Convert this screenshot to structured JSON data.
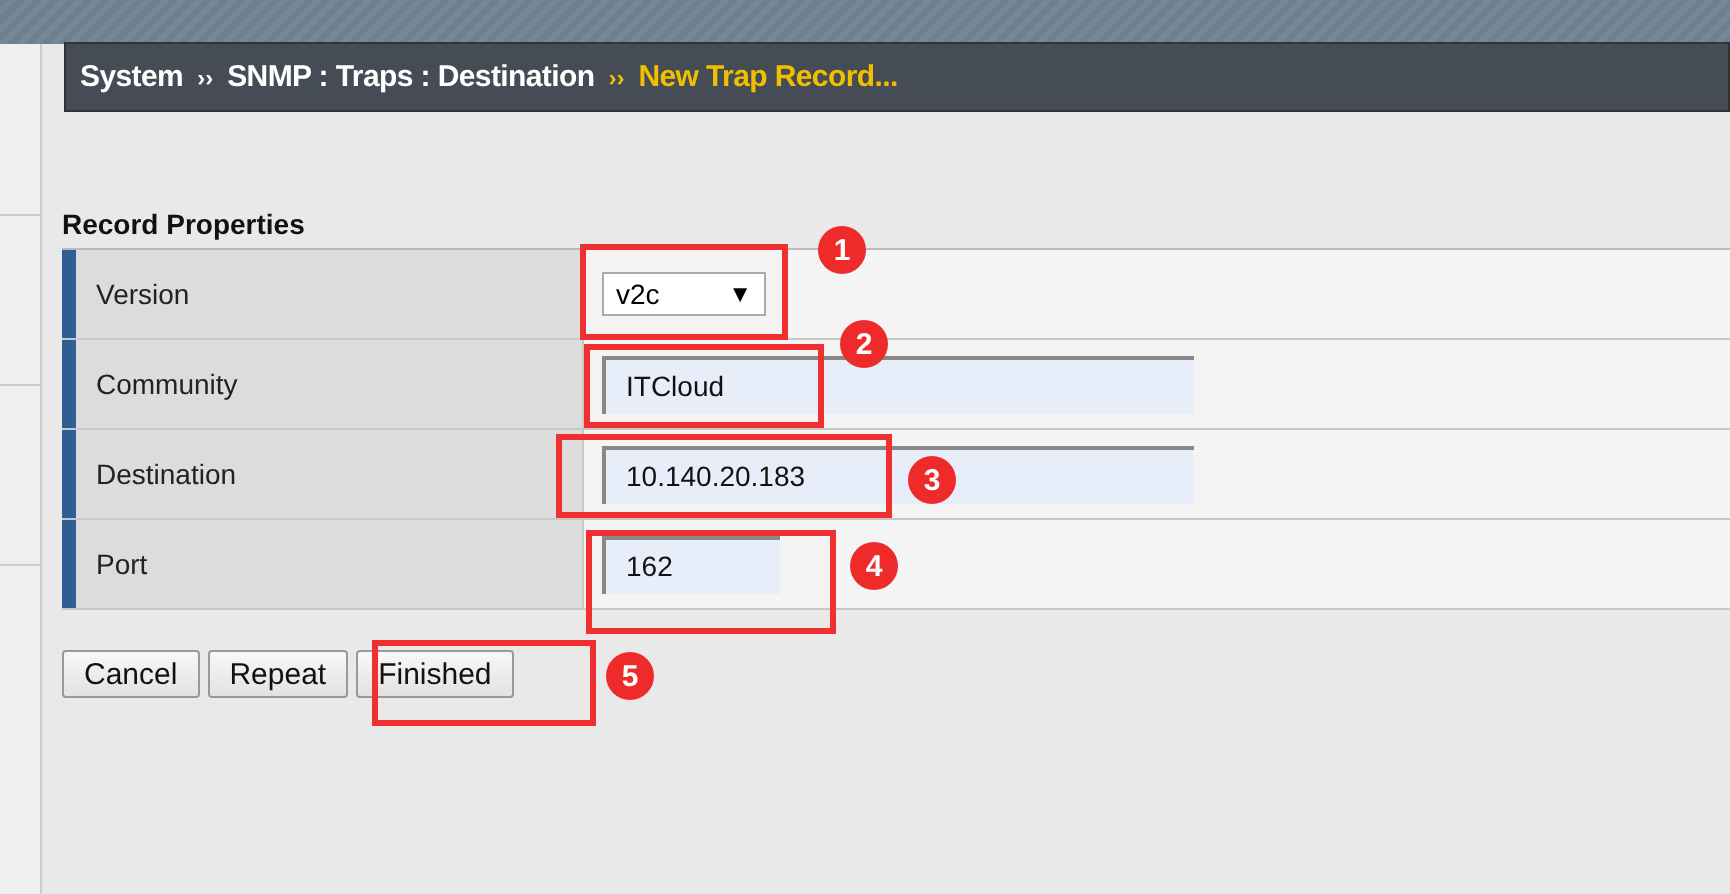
{
  "breadcrumb": [
    {
      "label": "System",
      "current": false
    },
    {
      "label": "SNMP : Traps : Destination",
      "current": false
    },
    {
      "label": "New Trap Record...",
      "current": true
    }
  ],
  "separator": "››",
  "section_title": "Record Properties",
  "fields": [
    {
      "label": "Version",
      "kind": "select",
      "value": "v2c",
      "caret": "▼"
    },
    {
      "label": "Community",
      "kind": "wide",
      "value": "ITCloud"
    },
    {
      "label": "Destination",
      "kind": "wide",
      "value": "10.140.20.183"
    },
    {
      "label": "Port",
      "kind": "short",
      "value": "162"
    }
  ],
  "buttons": [
    "Cancel",
    "Repeat",
    "Finished"
  ],
  "annotations": [
    {
      "number": "1"
    },
    {
      "number": "2"
    },
    {
      "number": "3"
    },
    {
      "number": "4"
    },
    {
      "number": "5"
    }
  ]
}
